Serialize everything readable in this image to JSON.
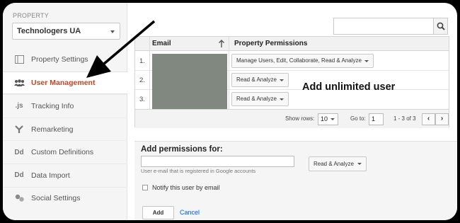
{
  "property": {
    "caption": "PROPERTY",
    "selected": "Technologers UA"
  },
  "nav": [
    {
      "label": "Property Settings",
      "icon": "property-settings-icon",
      "active": false
    },
    {
      "label": "User Management",
      "icon": "users-icon",
      "active": true
    },
    {
      "label": "Tracking Info",
      "icon": "js-icon",
      "icon_text": ".js",
      "active": false
    },
    {
      "label": "Remarketing",
      "icon": "remarketing-icon",
      "active": false
    },
    {
      "label": "Custom Definitions",
      "icon": "dd-icon",
      "icon_text": "Dd",
      "active": false
    },
    {
      "label": "Data Import",
      "icon": "dd-icon",
      "icon_text": "Dd",
      "active": false
    },
    {
      "label": "Social Settings",
      "icon": "social-icon",
      "active": false
    }
  ],
  "search": {
    "value": "",
    "icon": "search-icon"
  },
  "table": {
    "headers": {
      "email": "Email",
      "permissions": "Property Permissions"
    },
    "rows": [
      {
        "num": "1.",
        "permission": "Manage Users, Edit, Collaborate, Read & Analyze"
      },
      {
        "num": "2.",
        "permission": "Read & Analyze"
      },
      {
        "num": "3.",
        "permission": "Read & Analyze"
      }
    ],
    "pager": {
      "show_rows_label": "Show rows:",
      "show_rows_value": "10",
      "goto_label": "Go to:",
      "goto_value": "1",
      "range": "1 - 3 of 3",
      "prev": "‹",
      "next": "›"
    }
  },
  "annotation": "Add unlimited user",
  "add": {
    "title": "Add permissions for:",
    "email_value": "",
    "hint": "User e-mail that is registered in Google accounts",
    "permission": "Read & Analyze",
    "notify_label": "Notify this user by email",
    "add_label": "Add",
    "cancel_label": "Cancel"
  },
  "colors": {
    "active": "#d0411d",
    "link": "#1155cc",
    "blur": "#808880"
  }
}
